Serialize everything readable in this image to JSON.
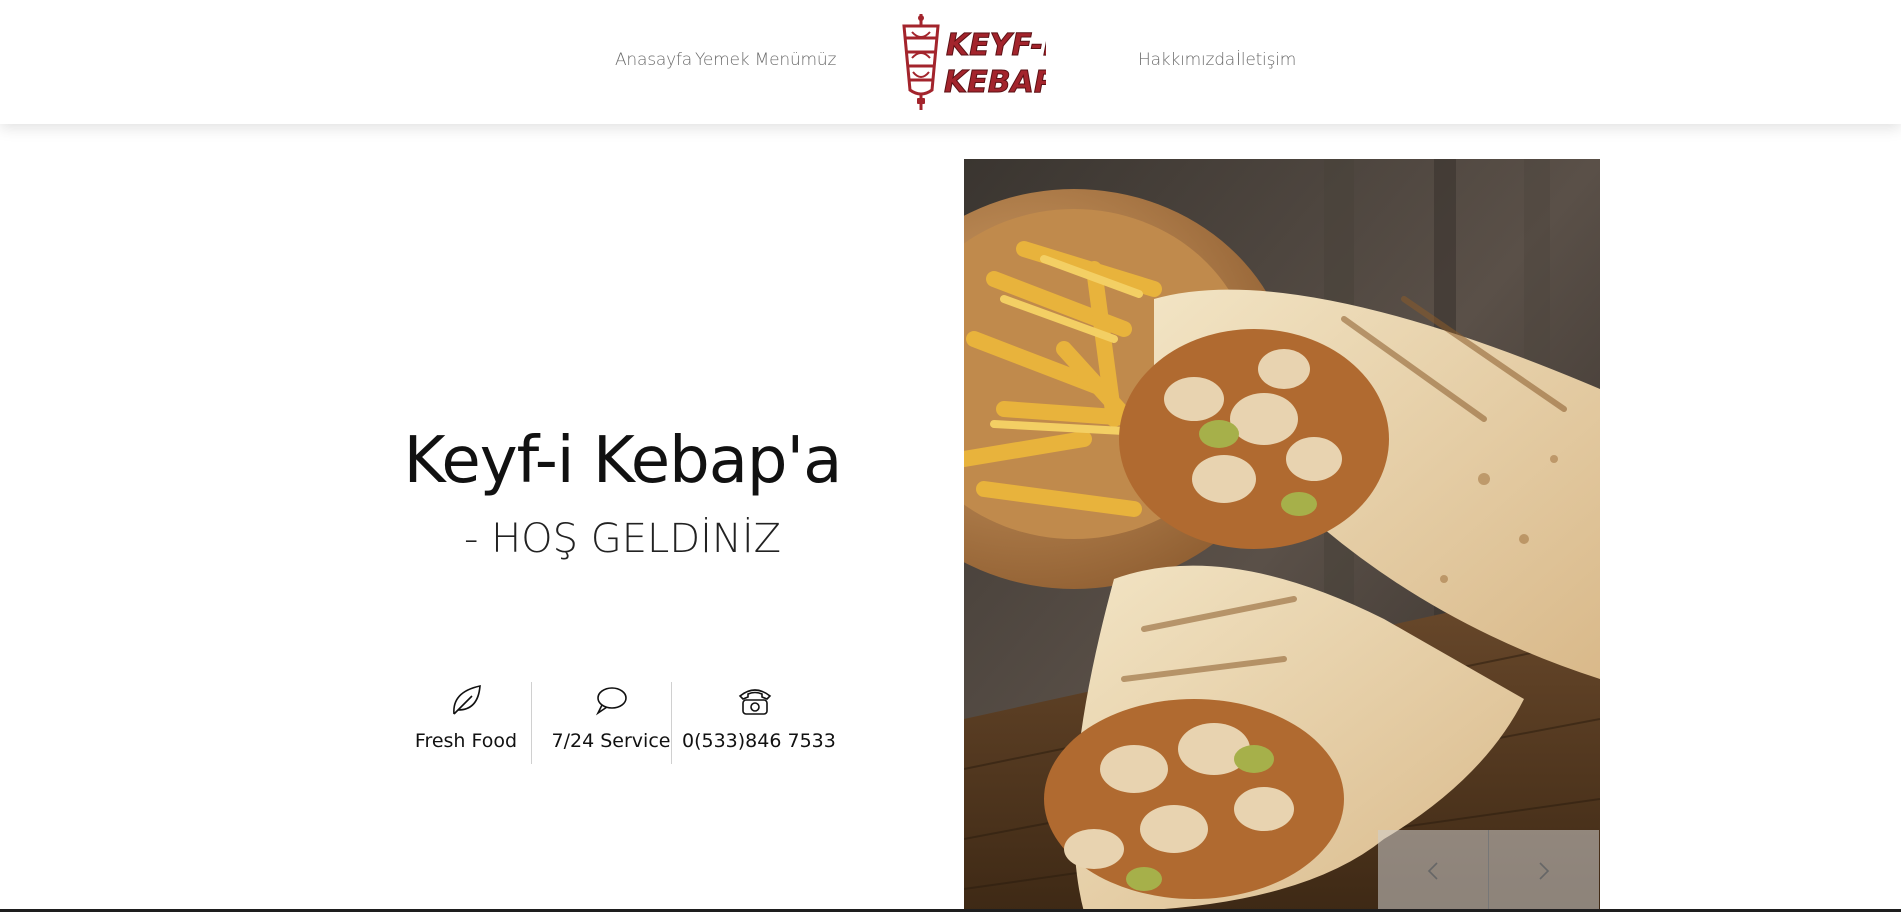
{
  "nav": {
    "left": [
      {
        "label": "Anasayfa"
      },
      {
        "label": "Yemek Menümüz"
      }
    ],
    "right": [
      {
        "label": "Hakkımızda"
      },
      {
        "label": "İletişim"
      }
    ],
    "logo": {
      "line1": "KEYF-i",
      "line2": "KEBAP"
    }
  },
  "hero": {
    "title": "Keyf-i Kebap'a",
    "subtitle": "- HOŞ GELDİNİZ"
  },
  "features": [
    {
      "icon": "leaf-icon",
      "label": "Fresh Food"
    },
    {
      "icon": "speech-bubble-icon",
      "label": "7/24 Service"
    },
    {
      "icon": "telephone-icon",
      "label": "0(533)846 7533"
    }
  ],
  "slider": {
    "prev_icon": "chevron-left-icon",
    "next_icon": "chevron-right-icon"
  },
  "colors": {
    "brand": "#a3242c",
    "text": "#111111",
    "nav": "#6b6b6b"
  }
}
